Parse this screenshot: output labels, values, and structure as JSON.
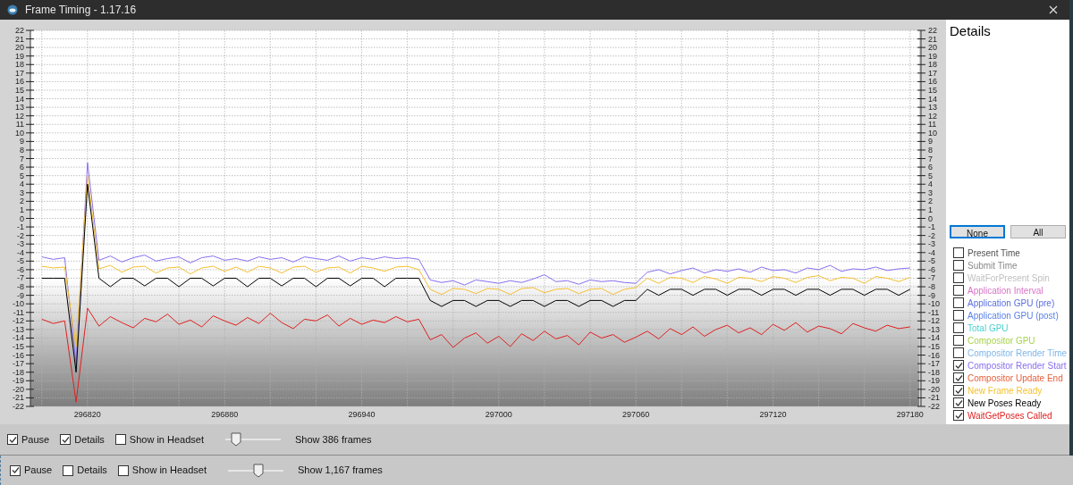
{
  "window": {
    "title": "Frame Timing - 1.17.16"
  },
  "chart_panel": {
    "right_axis_labels": [
      "22",
      "21",
      "20",
      "19",
      "18",
      "17",
      "16",
      "15",
      "14",
      "13",
      "12",
      "11",
      "10",
      "9",
      "8",
      "7",
      "6",
      "5",
      "4",
      "3",
      "2",
      "1",
      "0",
      "-1",
      "-2",
      "-3",
      "-4",
      "-5",
      "-6",
      "-7",
      "-8",
      "-9",
      "-10",
      "-11",
      "-12",
      "-13",
      "-14",
      "-15",
      "-16",
      "-17",
      "-18",
      "-19",
      "-20",
      "-21",
      "-22"
    ],
    "chart_data": {
      "type": "line",
      "grid": true,
      "xlim": [
        296795,
        297184
      ],
      "ylim": [
        -22,
        22
      ],
      "xticks": [
        296820,
        296880,
        296940,
        297000,
        297060,
        297120,
        297180
      ],
      "yticks": [
        22,
        21,
        20,
        19,
        18,
        17,
        16,
        15,
        14,
        13,
        12,
        11,
        10,
        9,
        8,
        7,
        6,
        5,
        4,
        3,
        2,
        1,
        0,
        -1,
        -2,
        -3,
        -4,
        -5,
        -6,
        -7,
        -8,
        -9,
        -10,
        -11,
        -12,
        -13,
        -14,
        -15,
        -16,
        -17,
        -18,
        -19,
        -20,
        -21,
        -22
      ],
      "x": [
        296800,
        296805,
        296810,
        296815,
        296820,
        296825,
        296830,
        296835,
        296840,
        296845,
        296850,
        296855,
        296860,
        296865,
        296870,
        296875,
        296880,
        296885,
        296890,
        296895,
        296900,
        296905,
        296910,
        296915,
        296920,
        296925,
        296930,
        296935,
        296940,
        296945,
        296950,
        296955,
        296960,
        296965,
        296970,
        296975,
        296980,
        296985,
        296990,
        296995,
        297000,
        297005,
        297010,
        297015,
        297020,
        297025,
        297030,
        297035,
        297040,
        297045,
        297050,
        297055,
        297060,
        297065,
        297070,
        297075,
        297080,
        297085,
        297090,
        297095,
        297100,
        297105,
        297110,
        297115,
        297120,
        297125,
        297130,
        297135,
        297140,
        297145,
        297150,
        297155,
        297160,
        297165,
        297170,
        297175,
        297180
      ],
      "series": [
        {
          "color": "#8a6ff0",
          "values": [
            -4.5,
            -4.8,
            -4.6,
            -17,
            6.5,
            -4.9,
            -4.4,
            -5.1,
            -4.6,
            -4.3,
            -5.0,
            -4.7,
            -4.5,
            -5.2,
            -4.6,
            -4.4,
            -4.9,
            -4.7,
            -5.0,
            -4.5,
            -4.8,
            -4.6,
            -5.1,
            -4.5,
            -4.7,
            -4.9,
            -4.4,
            -5.0,
            -4.6,
            -4.8,
            -4.5,
            -4.7,
            -4.6,
            -4.8,
            -7.2,
            -7.5,
            -7.3,
            -7.8,
            -7.2,
            -7.4,
            -7.6,
            -7.3,
            -7.5,
            -7.1,
            -6.6,
            -7.4,
            -7.3,
            -7.7,
            -7.2,
            -7.4,
            -7.3,
            -7.5,
            -7.6,
            -6.3,
            -6.0,
            -6.5,
            -6.1,
            -5.8,
            -6.4,
            -6.0,
            -6.2,
            -5.9,
            -6.3,
            -5.7,
            -6.1,
            -6.0,
            -6.4,
            -5.8,
            -6.0,
            -5.5,
            -6.2,
            -5.9,
            -6.0,
            -5.7,
            -6.1,
            -5.9,
            -5.8
          ]
        },
        {
          "color": "#f5c030",
          "values": [
            -5.6,
            -5.8,
            -5.7,
            -15,
            5.0,
            -5.9,
            -5.5,
            -6.3,
            -5.7,
            -5.6,
            -6.4,
            -5.8,
            -5.7,
            -6.5,
            -5.8,
            -5.6,
            -6.2,
            -5.7,
            -6.3,
            -5.6,
            -5.8,
            -6.4,
            -5.7,
            -5.6,
            -6.3,
            -5.8,
            -5.7,
            -6.4,
            -5.6,
            -5.8,
            -6.2,
            -5.7,
            -5.6,
            -6.0,
            -8.3,
            -8.9,
            -8.2,
            -8.3,
            -8.8,
            -8.2,
            -8.3,
            -8.9,
            -8.2,
            -8.1,
            -8.7,
            -8.3,
            -8.2,
            -8.8,
            -8.3,
            -8.2,
            -8.9,
            -8.3,
            -8.1,
            -7.0,
            -7.6,
            -6.9,
            -7.0,
            -7.5,
            -6.8,
            -7.1,
            -7.6,
            -6.9,
            -7.0,
            -7.4,
            -6.8,
            -7.0,
            -7.5,
            -6.9,
            -6.7,
            -7.3,
            -6.9,
            -7.0,
            -7.6,
            -6.8,
            -7.0,
            -7.4,
            -6.9
          ]
        },
        {
          "color": "#000000",
          "values": [
            -7.0,
            -7.0,
            -7.0,
            -18,
            4.0,
            -7.0,
            -8.0,
            -7.0,
            -7.0,
            -7.9,
            -7.0,
            -7.0,
            -8.0,
            -7.0,
            -7.0,
            -7.9,
            -7.0,
            -7.0,
            -8.0,
            -7.0,
            -7.0,
            -7.9,
            -7.0,
            -7.0,
            -8.0,
            -7.0,
            -7.0,
            -7.9,
            -7.0,
            -7.0,
            -8.0,
            -7.0,
            -7.0,
            -7.0,
            -9.6,
            -10.3,
            -9.6,
            -9.6,
            -10.3,
            -9.6,
            -9.6,
            -10.3,
            -9.6,
            -9.6,
            -10.3,
            -9.6,
            -9.6,
            -10.3,
            -9.6,
            -9.6,
            -10.3,
            -9.6,
            -9.6,
            -8.3,
            -9.0,
            -8.3,
            -8.3,
            -9.0,
            -8.3,
            -8.3,
            -9.0,
            -8.3,
            -8.3,
            -9.0,
            -8.3,
            -8.3,
            -9.0,
            -8.3,
            -8.3,
            -9.0,
            -8.3,
            -8.3,
            -9.0,
            -8.3,
            -8.3,
            -9.0,
            -8.3
          ]
        },
        {
          "color": "#e02020",
          "values": [
            -11.8,
            -12.3,
            -12.0,
            -21.5,
            -10.5,
            -12.6,
            -11.5,
            -12.2,
            -12.8,
            -11.7,
            -12.1,
            -11.2,
            -12.4,
            -11.9,
            -12.7,
            -11.4,
            -12.0,
            -12.5,
            -11.6,
            -12.3,
            -11.1,
            -12.2,
            -12.9,
            -11.8,
            -12.0,
            -11.3,
            -12.6,
            -11.7,
            -12.4,
            -11.9,
            -12.2,
            -11.5,
            -12.1,
            -11.8,
            -14.2,
            -13.6,
            -15.1,
            -14.0,
            -13.4,
            -14.6,
            -13.8,
            -15.0,
            -13.5,
            -14.3,
            -13.2,
            -14.1,
            -13.7,
            -14.8,
            -13.3,
            -14.0,
            -13.6,
            -14.5,
            -13.9,
            -13.2,
            -14.1,
            -12.9,
            -13.6,
            -12.7,
            -13.8,
            -13.0,
            -12.5,
            -13.4,
            -12.8,
            -13.6,
            -12.4,
            -13.1,
            -12.2,
            -13.3,
            -12.6,
            -12.9,
            -13.5,
            -12.3,
            -12.8,
            -13.2,
            -12.5,
            -12.9,
            -12.7
          ]
        }
      ]
    }
  },
  "details": {
    "title": "Details",
    "buttons": [
      {
        "label": "None",
        "selected": true
      },
      {
        "label": "All",
        "selected": false
      }
    ],
    "toggles": [
      {
        "label": "Present Time",
        "color": "#505050",
        "checked": false
      },
      {
        "label": "Submit Time",
        "color": "#8a8a8a",
        "checked": false
      },
      {
        "label": "WaitForPresent Spin",
        "color": "#c0c0c0",
        "checked": false
      },
      {
        "label": "Application Interval",
        "color": "#d873c8",
        "checked": false
      },
      {
        "label": "Application GPU (pre)",
        "color": "#5a6ee0",
        "checked": false
      },
      {
        "label": "Application GPU (post)",
        "color": "#5a82e8",
        "checked": false
      },
      {
        "label": "Total GPU",
        "color": "#4ccfd0",
        "checked": false
      },
      {
        "label": "Compositor GPU",
        "color": "#a8d24c",
        "checked": false
      },
      {
        "label": "Compositor Render Time",
        "color": "#7fb6ea",
        "checked": false
      },
      {
        "label": "Compositor Render Start",
        "color": "#8a6ff0",
        "checked": true
      },
      {
        "label": "Compositor Update End",
        "color": "#e8603c",
        "checked": true
      },
      {
        "label": "New Frame Ready",
        "color": "#f5c030",
        "checked": true
      },
      {
        "label": "New Poses Ready",
        "color": "#000000",
        "checked": true
      },
      {
        "label": "WaitGetPoses Called",
        "color": "#e02020",
        "checked": true
      }
    ]
  },
  "toolbar": {
    "checkboxes": [
      {
        "label": "Pause",
        "checked": true
      },
      {
        "label": "Details",
        "checked": true
      },
      {
        "label": "Show in Headset",
        "checked": false
      }
    ],
    "slider": {
      "level": 0.2
    },
    "frames_label": "Show 386 frames"
  },
  "background_toolbar": {
    "checkboxes": [
      {
        "label": "Pause",
        "checked": true
      },
      {
        "label": "Details",
        "checked": false
      },
      {
        "label": "Show in Headset",
        "checked": false
      }
    ],
    "slider": {
      "level": 0.55
    },
    "frames_label": "Show 1,167 frames"
  }
}
